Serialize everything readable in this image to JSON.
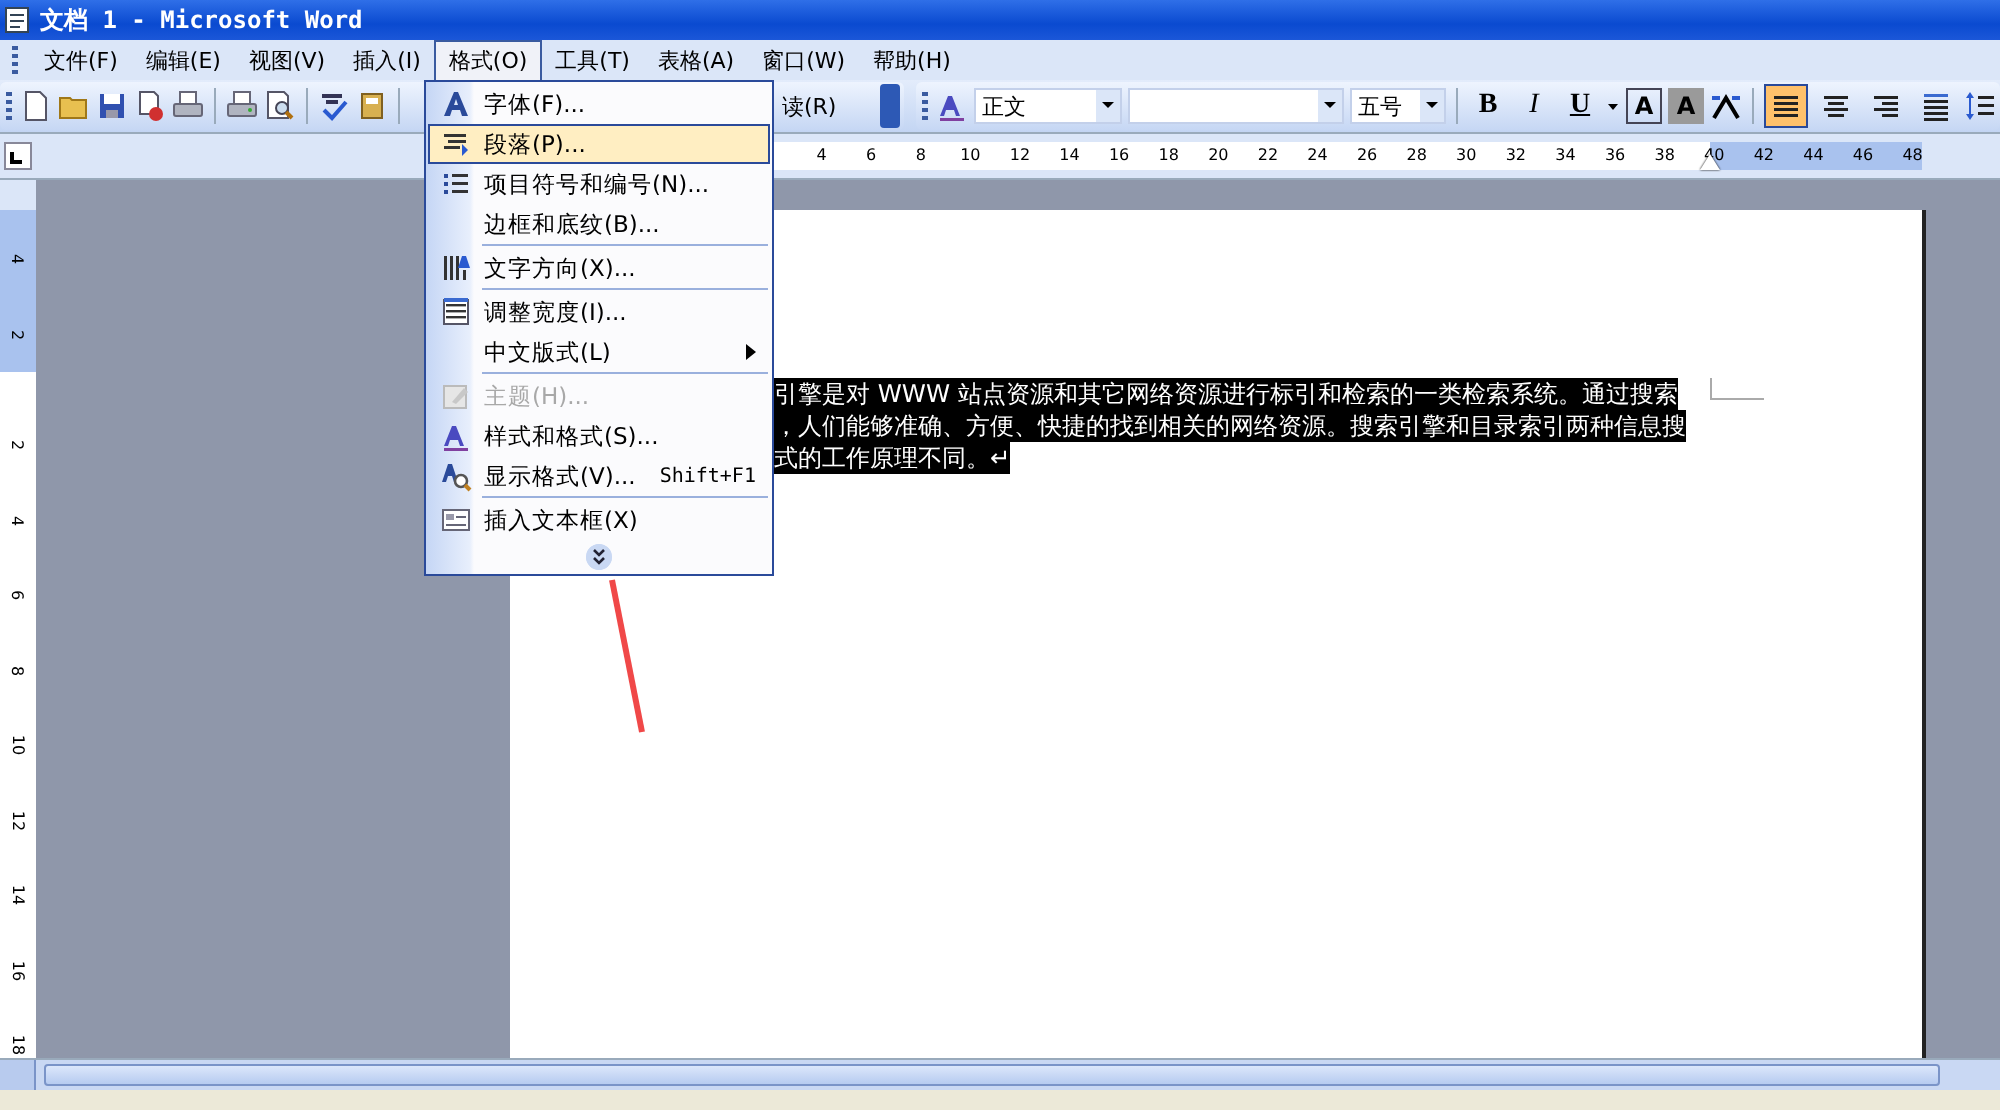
{
  "window": {
    "title": "文档 1 - Microsoft Word"
  },
  "menu_bar": [
    {
      "label": "文件(F)",
      "selected": false
    },
    {
      "label": "编辑(E)",
      "selected": false
    },
    {
      "label": "视图(V)",
      "selected": false
    },
    {
      "label": "插入(I)",
      "selected": false
    },
    {
      "label": "格式(O)",
      "selected": true
    },
    {
      "label": "工具(T)",
      "selected": false
    },
    {
      "label": "表格(A)",
      "selected": false
    },
    {
      "label": "窗口(W)",
      "selected": false
    },
    {
      "label": "帮助(H)",
      "selected": false
    }
  ],
  "toolbar": {
    "read_button": "读(R)",
    "style": "正文",
    "size": "五号",
    "format_buttons": [
      {
        "kind": "bold",
        "label": "B"
      },
      {
        "kind": "italic",
        "label": "I"
      },
      {
        "kind": "underline",
        "label": "U"
      },
      {
        "kind": "border",
        "label": "A"
      },
      {
        "kind": "shade",
        "label": "A"
      }
    ],
    "align_buttons": [
      {
        "selected": true
      },
      {
        "selected": false
      },
      {
        "selected": false
      },
      {
        "selected": false
      }
    ]
  },
  "ruler": {
    "marks": [
      "4",
      "6",
      "8",
      "10",
      "12",
      "14",
      "16",
      "18",
      "20",
      "22",
      "24",
      "26",
      "28",
      "30",
      "32",
      "34",
      "36",
      "38",
      "40",
      "42",
      "44",
      "46",
      "48"
    ]
  },
  "vertical_ruler": {
    "top_marks": [
      "4",
      "2"
    ],
    "marks": [
      "2",
      "4",
      "6",
      "8",
      "10",
      "12",
      "14",
      "16",
      "18"
    ]
  },
  "document": {
    "lines": [
      "引擎是对 WWW 站点资源和其它网络资源进行标引和检索的一类检索系统。通过搜索",
      "，人们能够准确、方便、快捷的找到相关的网络资源。搜索引擎和目录索引两种信息搜",
      "式的工作原理不同。↵"
    ]
  },
  "format_menu": {
    "items": [
      {
        "kind": "item",
        "label": "字体(F)...",
        "selected": false,
        "disabled": false,
        "submenu": false
      },
      {
        "kind": "item",
        "label": "段落(P)...",
        "selected": true,
        "disabled": false,
        "submenu": false
      },
      {
        "kind": "item",
        "label": "项目符号和编号(N)...",
        "selected": false,
        "disabled": false,
        "submenu": false
      },
      {
        "kind": "item",
        "label": "边框和底纹(B)...",
        "selected": false,
        "disabled": false,
        "submenu": false
      },
      {
        "kind": "separator"
      },
      {
        "kind": "item",
        "label": "文字方向(X)...",
        "selected": false,
        "disabled": false,
        "submenu": false
      },
      {
        "kind": "separator"
      },
      {
        "kind": "item",
        "label": "调整宽度(I)...",
        "selected": false,
        "disabled": false,
        "submenu": false
      },
      {
        "kind": "item",
        "label": "中文版式(L)",
        "selected": false,
        "disabled": false,
        "submenu": true
      },
      {
        "kind": "separator"
      },
      {
        "kind": "item",
        "label": "主题(H)...",
        "selected": false,
        "disabled": true,
        "submenu": false
      },
      {
        "kind": "item",
        "label": "样式和格式(S)...",
        "selected": false,
        "disabled": false,
        "submenu": false
      },
      {
        "kind": "item",
        "label": "显示格式(V)...",
        "shortcut": "Shift+F1",
        "selected": false,
        "disabled": false,
        "submenu": false
      },
      {
        "kind": "separator"
      },
      {
        "kind": "item",
        "label": "插入文本框(X)",
        "selected": false,
        "disabled": false,
        "submenu": false
      },
      {
        "kind": "more"
      }
    ]
  }
}
